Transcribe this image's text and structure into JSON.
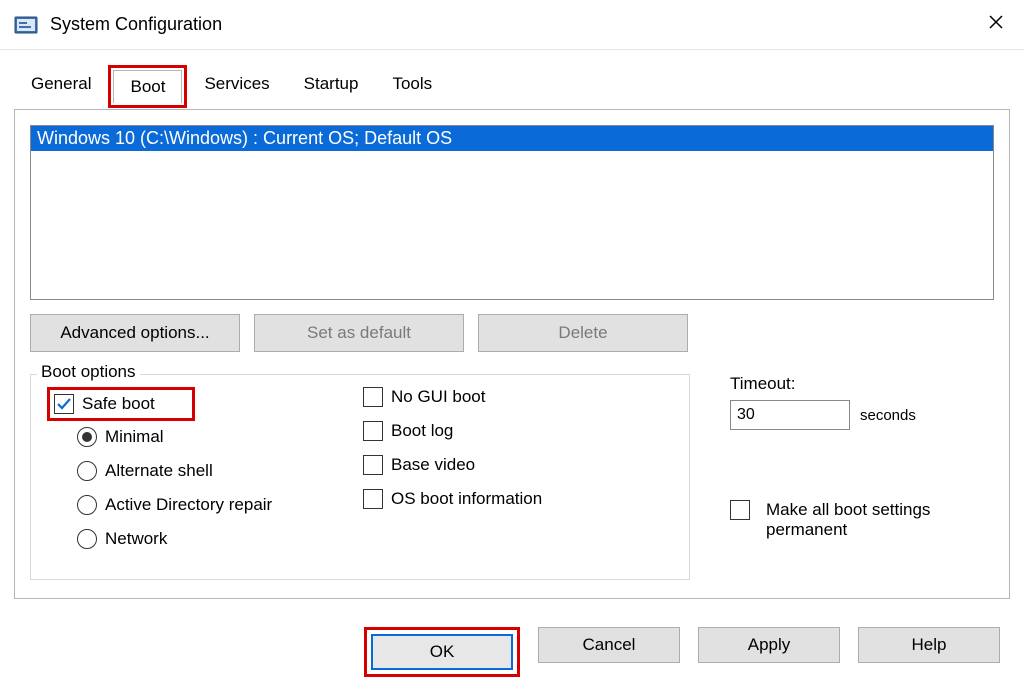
{
  "window": {
    "title": "System Configuration",
    "icon": "msconfig-icon"
  },
  "tabs": [
    {
      "label": "General",
      "active": false
    },
    {
      "label": "Boot",
      "active": true,
      "highlighted": true
    },
    {
      "label": "Services",
      "active": false
    },
    {
      "label": "Startup",
      "active": false
    },
    {
      "label": "Tools",
      "active": false
    }
  ],
  "os_list": {
    "selected": "Windows 10 (C:\\Windows) : Current OS; Default OS"
  },
  "os_buttons": {
    "advanced": "Advanced options...",
    "set_default": "Set as default",
    "delete": "Delete"
  },
  "boot_options": {
    "legend": "Boot options",
    "safe_boot": {
      "label": "Safe boot",
      "checked": true,
      "highlighted": true
    },
    "radios": {
      "minimal": "Minimal",
      "alternate_shell": "Alternate shell",
      "ad_repair": "Active Directory repair",
      "network": "Network",
      "selected": "minimal"
    },
    "no_gui": {
      "label": "No GUI boot",
      "checked": false
    },
    "boot_log": {
      "label": "Boot log",
      "checked": false
    },
    "base_video": {
      "label": "Base video",
      "checked": false
    },
    "os_boot_info": {
      "label": "OS boot information",
      "checked": false
    }
  },
  "timeout": {
    "label": "Timeout:",
    "value": "30",
    "unit": "seconds"
  },
  "permanent": {
    "label": "Make all boot settings permanent",
    "checked": false
  },
  "footer": {
    "ok": "OK",
    "cancel": "Cancel",
    "apply": "Apply",
    "help": "Help"
  }
}
